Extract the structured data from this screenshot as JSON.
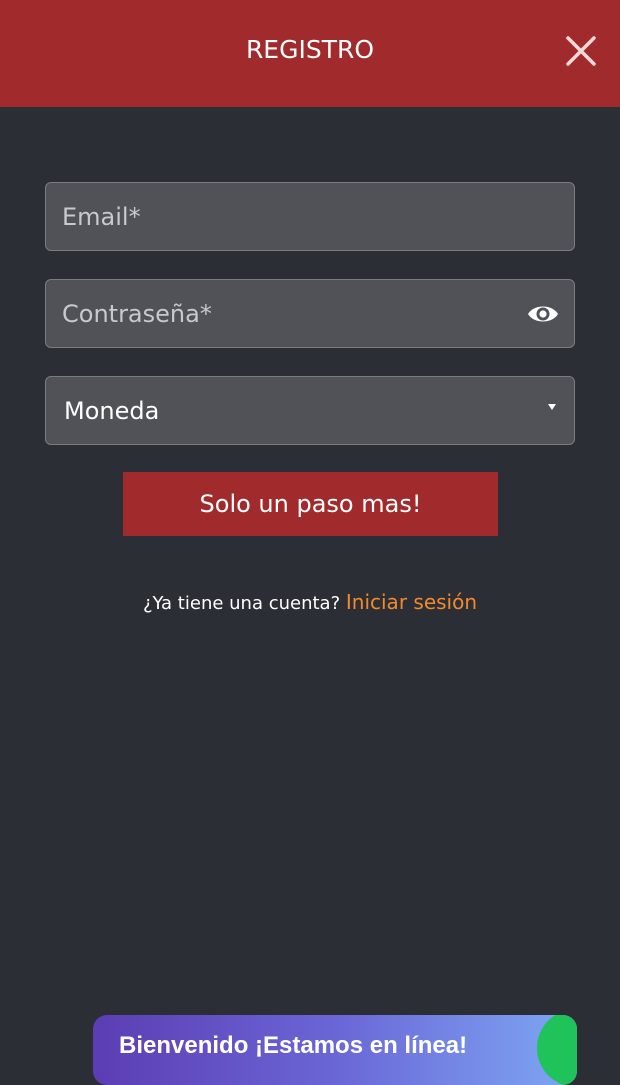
{
  "header": {
    "title": "REGISTRO",
    "close_icon": "close-icon"
  },
  "form": {
    "email": {
      "placeholder": "Email*",
      "value": ""
    },
    "password": {
      "placeholder": "Contraseña*",
      "value": "",
      "toggle_icon": "eye-icon"
    },
    "currency": {
      "selected": "Moneda",
      "caret_icon": "caret-down-icon"
    },
    "submit_label": "Solo un paso mas!"
  },
  "login": {
    "question": "¿Ya tiene una cuenta?",
    "link_label": "Iniciar sesión"
  },
  "chat": {
    "label": "Bienvenido ¡Estamos en línea!"
  },
  "colors": {
    "background": "#2c2e35",
    "accent_red": "#a12a2c",
    "field_bg": "#505258",
    "link_orange": "#f28a2d",
    "chat_green": "#1fc35a"
  }
}
